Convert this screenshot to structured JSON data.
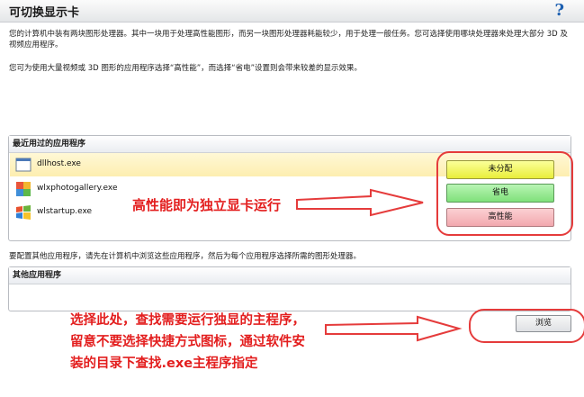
{
  "header": {
    "title": "可切换显示卡",
    "help": "?"
  },
  "description": {
    "line1": "您的计算机中装有两块图形处理器。其中一块用于处理高性能图形，而另一块图形处理器耗能较少，用于处理一般任务。您可选择使用哪块处理器来处理大部分 3D 及视频应用程序。",
    "line2": "您可为使用大量视频或 3D 图形的应用程序选择“高性能”，而选择“省电”设置则会带来较差的显示效果。"
  },
  "recent": {
    "header": "最近用过的应用程序",
    "apps": [
      {
        "name": "dllhost.exe",
        "icon": "generic-app-icon"
      },
      {
        "name": "wlxphotogallery.exe",
        "icon": "photo-gallery-icon"
      },
      {
        "name": "wlstartup.exe",
        "icon": "windows-flag-icon"
      }
    ],
    "gpu_options": [
      {
        "label": "未分配",
        "color": "#f0f25a"
      },
      {
        "label": "省电",
        "color": "#9ae996"
      },
      {
        "label": "高性能",
        "color": "#f5b8bd"
      }
    ]
  },
  "configure_text": "要配置其他应用程序，请先在计算机中浏览这些应用程序，然后为每个应用程序选择所需的图形处理器。",
  "other": {
    "header": "其他应用程序"
  },
  "browse_label": "浏览",
  "annotations": {
    "high_perf_note": "高性能即为独立显卡运行",
    "browse_note": "选择此处，查找需要运行独显的主程序，留意不要选择快捷方式图标，通过软件安装的目录下查找.exe主程序指定",
    "accent_color": "#e31e1e"
  }
}
